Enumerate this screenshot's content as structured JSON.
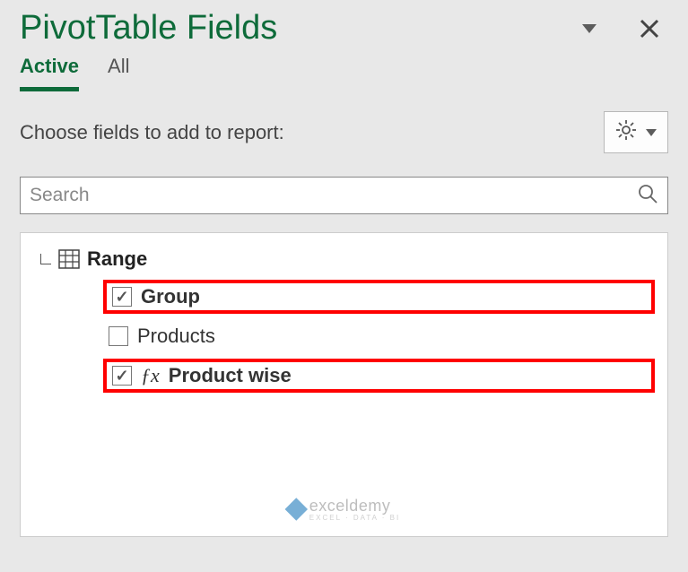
{
  "header": {
    "title": "PivotTable Fields"
  },
  "tabs": {
    "active": "Active",
    "all": "All"
  },
  "instruction": "Choose fields to add to report:",
  "search": {
    "placeholder": "Search"
  },
  "tree": {
    "root": "Range",
    "fields": [
      {
        "label": "Group",
        "checked": true,
        "fx": false,
        "highlight": true
      },
      {
        "label": "Products",
        "checked": false,
        "fx": false,
        "highlight": false
      },
      {
        "label": "Product wise",
        "checked": true,
        "fx": true,
        "highlight": true
      }
    ]
  },
  "watermark": {
    "brand": "exceldemy",
    "tagline": "EXCEL · DATA · BI"
  }
}
